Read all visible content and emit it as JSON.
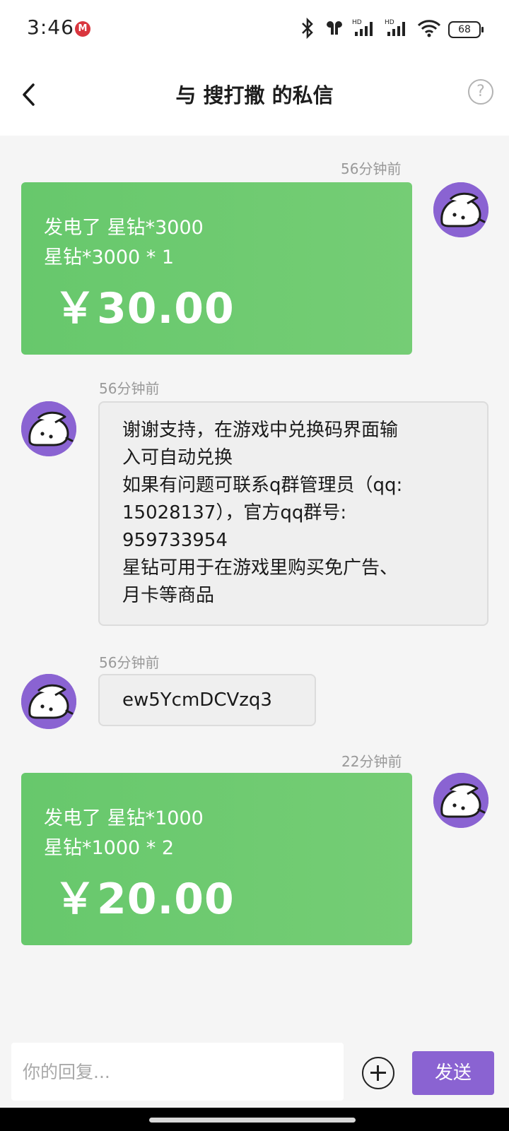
{
  "status_bar": {
    "time": "3:46",
    "battery": "68",
    "app_icon_label": "M",
    "icons": [
      "bluetooth-icon",
      "earbuds-icon",
      "signal-hd-icon",
      "signal-hd-icon",
      "wifi-icon",
      "battery-icon"
    ]
  },
  "header": {
    "back_icon": "chevron-left-icon",
    "title": "与 搜打撒 的私信",
    "help_label": "?"
  },
  "messages": [
    {
      "side": "right",
      "timestamp": "56分钟前",
      "type": "order",
      "line1": "发电了 星钻*3000",
      "line2": "星钻*3000 * 1",
      "amount": "￥30.00"
    },
    {
      "side": "left",
      "timestamp": "56分钟前",
      "type": "text",
      "text": "谢谢支持，在游戏中兑换码界面输\n入可自动兑换\n如果有问题可联系q群管理员（qq:\n15028137），官方qq群号:\n959733954\n星钻可用于在游戏里购买免广告、\n月卡等商品"
    },
    {
      "side": "left",
      "timestamp": "56分钟前",
      "type": "text",
      "text": "ew5YcmDCVzq3"
    },
    {
      "side": "right",
      "timestamp": "22分钟前",
      "type": "order",
      "line1": "发电了 星钻*1000",
      "line2": "星钻*1000 * 2",
      "amount": "￥20.00"
    }
  ],
  "input_bar": {
    "placeholder": "你的回复...",
    "value": "",
    "send_label": "发送"
  },
  "colors": {
    "accent": "#8a63d2",
    "order_bubble": "#6dca70",
    "text_bubble": "#efefef",
    "background": "#f5f5f5"
  }
}
